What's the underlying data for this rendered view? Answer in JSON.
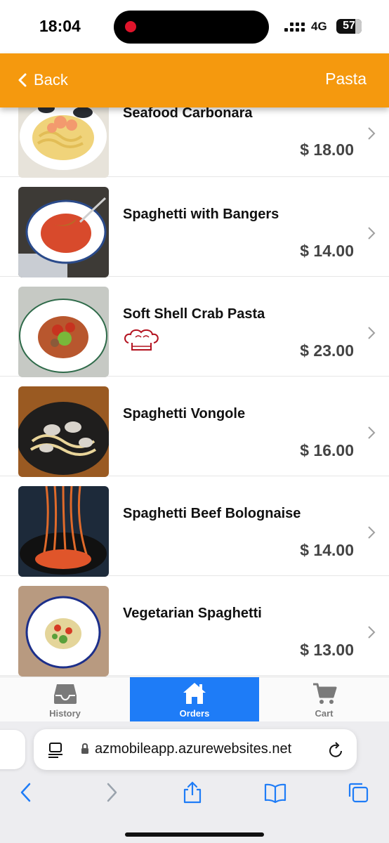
{
  "status_bar": {
    "time": "18:04",
    "network": "4G",
    "battery": "57"
  },
  "header": {
    "back_label": "Back",
    "title": "Pasta"
  },
  "menu_items": [
    {
      "name": "Seafood Carbonara",
      "price": "$ 18.00",
      "chef_special": false
    },
    {
      "name": "Spaghetti with Bangers",
      "price": "$ 14.00",
      "chef_special": false
    },
    {
      "name": "Soft Shell Crab Pasta",
      "price": "$ 23.00",
      "chef_special": true
    },
    {
      "name": "Spaghetti Vongole",
      "price": "$ 16.00",
      "chef_special": false
    },
    {
      "name": "Spaghetti Beef Bolognaise",
      "price": "$ 14.00",
      "chef_special": false
    },
    {
      "name": "Vegetarian Spaghetti",
      "price": "$ 13.00",
      "chef_special": false
    }
  ],
  "tabs": [
    {
      "label": "History",
      "icon": "inbox-icon",
      "active": false
    },
    {
      "label": "Orders",
      "icon": "home-icon",
      "active": true
    },
    {
      "label": "Cart",
      "icon": "cart-icon",
      "active": false
    }
  ],
  "browser": {
    "url": "azmobileapp.azurewebsites.net"
  },
  "colors": {
    "header": "#f5990e",
    "active_tab": "#1e7cf7",
    "chef_icon": "#b3121f"
  }
}
